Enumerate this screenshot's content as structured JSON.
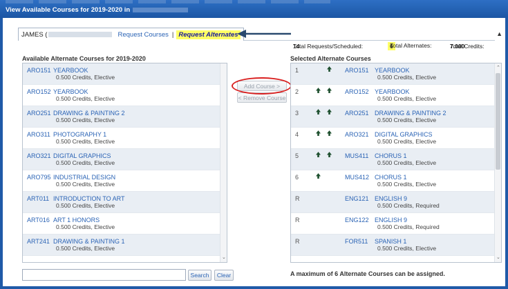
{
  "window": {
    "title": "View Available Courses for 2019-2020 in"
  },
  "tabs": {
    "student_name": "JAMES (",
    "request_courses": "Request Courses",
    "separator": "|",
    "request_alternates": "Request Alternates"
  },
  "totals": {
    "requests_label": "Total Requests/Scheduled:",
    "requests_value": "14",
    "alternates_label": "Total Alternates:",
    "alternates_value": "6",
    "credits_label": "Total Credits:",
    "credits_value": "7.000"
  },
  "available": {
    "heading": "Available Alternate Courses for 2019-2020",
    "items": [
      {
        "code": "ARO151",
        "name": "YEARBOOK",
        "credits": "0.500 Credits,  Elective"
      },
      {
        "code": "ARO152",
        "name": "YEARBOOK",
        "credits": "0.500 Credits,  Elective"
      },
      {
        "code": "ARO251",
        "name": "DRAWING & PAINTING 2",
        "credits": "0.500 Credits,  Elective"
      },
      {
        "code": "ARO311",
        "name": "PHOTOGRAPHY 1",
        "credits": "0.500 Credits,  Elective"
      },
      {
        "code": "ARO321",
        "name": "DIGITAL GRAPHICS",
        "credits": "0.500 Credits,  Elective"
      },
      {
        "code": "ARO795",
        "name": "INDUSTRIAL DESIGN",
        "credits": "0.500 Credits,  Elective"
      },
      {
        "code": "ART011",
        "name": "INTRODUCTION TO ART",
        "credits": "0.500 Credits,  Elective"
      },
      {
        "code": "ART016",
        "name": "ART 1 HONORS",
        "credits": "0.500 Credits,  Elective"
      },
      {
        "code": "ART241",
        "name": "DRAWING & PAINTING 1",
        "credits": "0.500 Credits,  Elective"
      }
    ]
  },
  "buttons": {
    "add_course": "Add Course >",
    "remove_course": "< Remove Course",
    "search": "Search",
    "clear": "Clear"
  },
  "search": {
    "value": ""
  },
  "selected": {
    "heading": "Selected Alternate Courses",
    "items": [
      {
        "rank": "1",
        "code": "ARO151",
        "name": "YEARBOOK",
        "credits": "0.500 Credits,  Elective"
      },
      {
        "rank": "2",
        "code": "ARO152",
        "name": "YEARBOOK",
        "credits": "0.500 Credits,  Elective"
      },
      {
        "rank": "3",
        "code": "ARO251",
        "name": "DRAWING & PAINTING 2",
        "credits": "0.500 Credits,  Elective"
      },
      {
        "rank": "4",
        "code": "ARO321",
        "name": "DIGITAL GRAPHICS",
        "credits": "0.500 Credits,  Elective"
      },
      {
        "rank": "5",
        "code": "MUS411",
        "name": "CHORUS 1",
        "credits": "0.500 Credits,  Elective"
      },
      {
        "rank": "6",
        "code": "MUS412",
        "name": "CHORUS 1",
        "credits": "0.500 Credits,  Elective"
      },
      {
        "rank": "R",
        "code": "ENG121",
        "name": "ENGLISH 9",
        "credits": "0.500 Credits,  Required"
      },
      {
        "rank": "R",
        "code": "ENG122",
        "name": "ENGLISH 9",
        "credits": "0.500 Credits,  Required"
      },
      {
        "rank": "R",
        "code": "FOR511",
        "name": "SPANISH 1",
        "credits": "0.500 Credits,  Elective"
      }
    ],
    "max_note": "A maximum of 6 Alternate Courses can be assigned."
  },
  "colors": {
    "title_bar": "#1f5aa8",
    "link": "#2a63b5",
    "highlight": "#ffff66",
    "annotation_red": "#d92020"
  }
}
